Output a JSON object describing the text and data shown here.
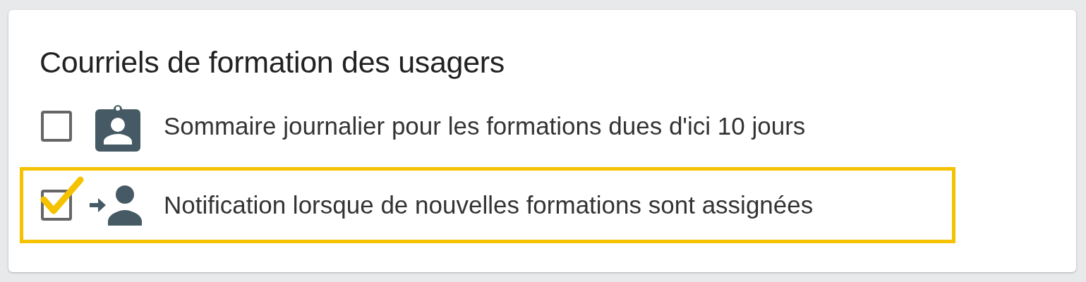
{
  "card": {
    "title": "Courriels de formation des usagers",
    "options": [
      {
        "kind": "badge",
        "label": "Sommaire journalier pour les formations dues d'ici 10 jours",
        "checked": false,
        "highlighted": false
      },
      {
        "kind": "assign",
        "label": "Notification lorsque de nouvelles formations sont assignées",
        "checked": true,
        "highlighted": true
      }
    ]
  }
}
